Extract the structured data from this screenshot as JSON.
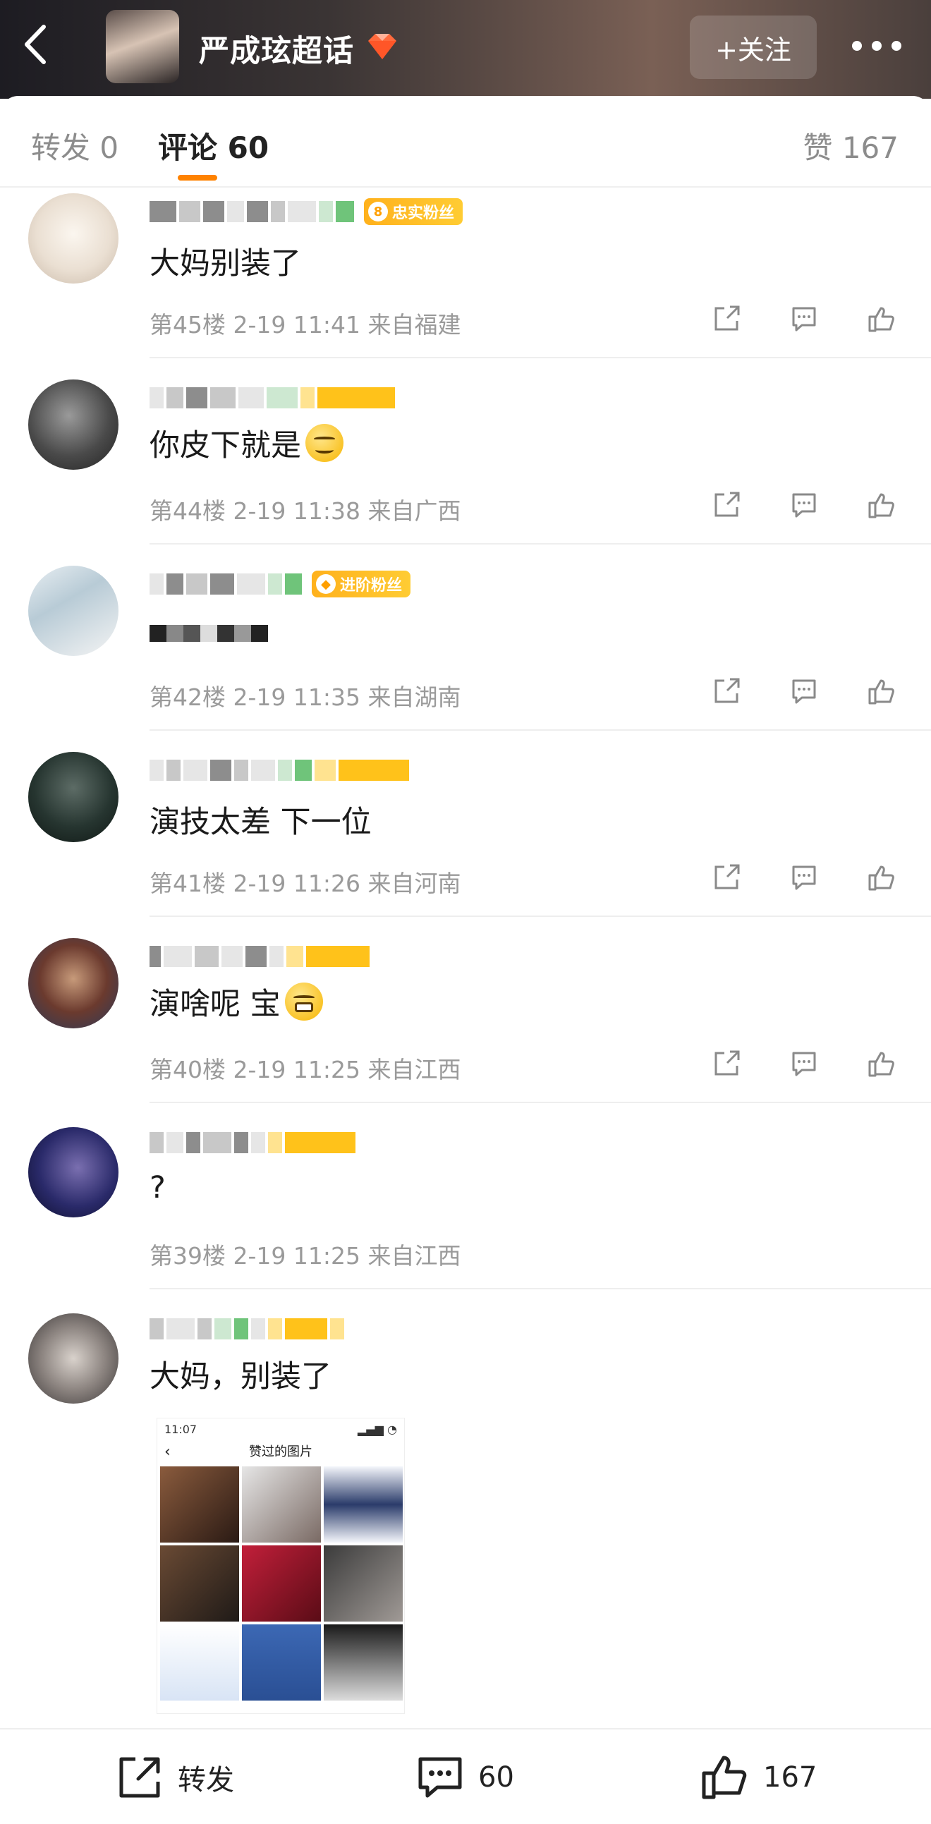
{
  "header": {
    "title": "严成玹超话",
    "follow_label": "+关注",
    "accent": "#ff8200"
  },
  "tabs": {
    "repost": "转发 0",
    "comments": "评论 60",
    "likes": "赞 167"
  },
  "comments": [
    {
      "badge": "忠实粉丝",
      "badge_level": "8",
      "text": "大妈别装了",
      "meta": "第45楼 2-19 11:41 来自福建"
    },
    {
      "badge": "",
      "text": "你皮下就是",
      "emoji": "smirk-emoji",
      "meta": "第44楼 2-19 11:38 来自广西"
    },
    {
      "badge": "进阶粉丝",
      "badge_level": "",
      "text": "",
      "meta": "第42楼 2-19 11:35 来自湖南"
    },
    {
      "badge": "",
      "text": "演技太差 下一位",
      "meta": "第41楼 2-19 11:26 来自河南"
    },
    {
      "badge": "",
      "text": "演啥呢 宝",
      "emoji": "grin-emoji",
      "meta": "第40楼 2-19 11:25 来自江西"
    },
    {
      "badge": "",
      "text": "?",
      "meta": "第39楼 2-19 11:25 来自江西"
    },
    {
      "badge": "",
      "text": "大妈，别装了",
      "meta": ""
    }
  ],
  "attached_screenshot": {
    "time": "11:07",
    "title": "赞过的图片"
  },
  "bottom": {
    "repost": "转发",
    "comments": "60",
    "likes": "167"
  }
}
